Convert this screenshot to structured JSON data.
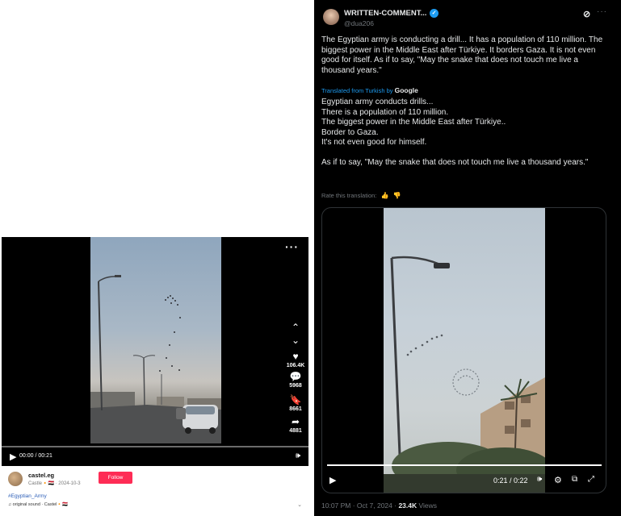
{
  "tiktok": {
    "more_icon": "more-icon",
    "actions": [
      {
        "icon": "chevron-up-icon",
        "glyph": "⌃",
        "count": ""
      },
      {
        "icon": "chevron-down-icon",
        "glyph": "⌄",
        "count": ""
      },
      {
        "icon": "heart-icon",
        "glyph": "♥",
        "count": "106.4K"
      },
      {
        "icon": "comment-icon",
        "glyph": "💬",
        "count": "5968"
      },
      {
        "icon": "bookmark-icon",
        "glyph": "🔖",
        "count": "8661"
      },
      {
        "icon": "share-icon",
        "glyph": "➦",
        "count": "4881"
      }
    ],
    "time": "00:00 / 00:21",
    "username": "castel.eg",
    "subline": "Castle🔸🇪🇬 · 2024-10-3",
    "follow_label": "Follow",
    "hashtag": "#Egyptian_Army",
    "sound": "♫ original sound · Castel🔸🇪🇬",
    "colors": {
      "follow": "#fe2c55",
      "hashtag": "#2b5db7"
    }
  },
  "tweet": {
    "name": "WRITTEN-COMMENT...",
    "handle": "@dua206",
    "text": "The Egyptian army is conducting a drill... It has a population of 110 million. The biggest power in the Middle East after Türkiye. It borders Gaza. It is not even good for itself. As if to say, \"May the snake that does not touch me live a thousand years.\"",
    "translated_prefix": "Translated from Turkish by",
    "translated_brand": "Google",
    "original_lines": [
      "Egyptian army conducts drills...",
      "There is a population of 110 million.",
      "The biggest power in the Middle East after Türkiye..",
      "Border to Gaza.",
      "It's not even good for himself.",
      "",
      "As if to say, \"May the snake that does not touch me live a thousand years.\""
    ],
    "rate_label": "Rate this translation:",
    "video_time": "0:21 / 0:22",
    "progress_fraction": 1.0,
    "timestamp": "10:07 PM · Oct 7, 2024 · ",
    "views_count": "23.4K",
    "views_label": " Views",
    "colors": {
      "accent": "#1d9bf0",
      "background": "#000000",
      "muted": "#71767b"
    }
  }
}
